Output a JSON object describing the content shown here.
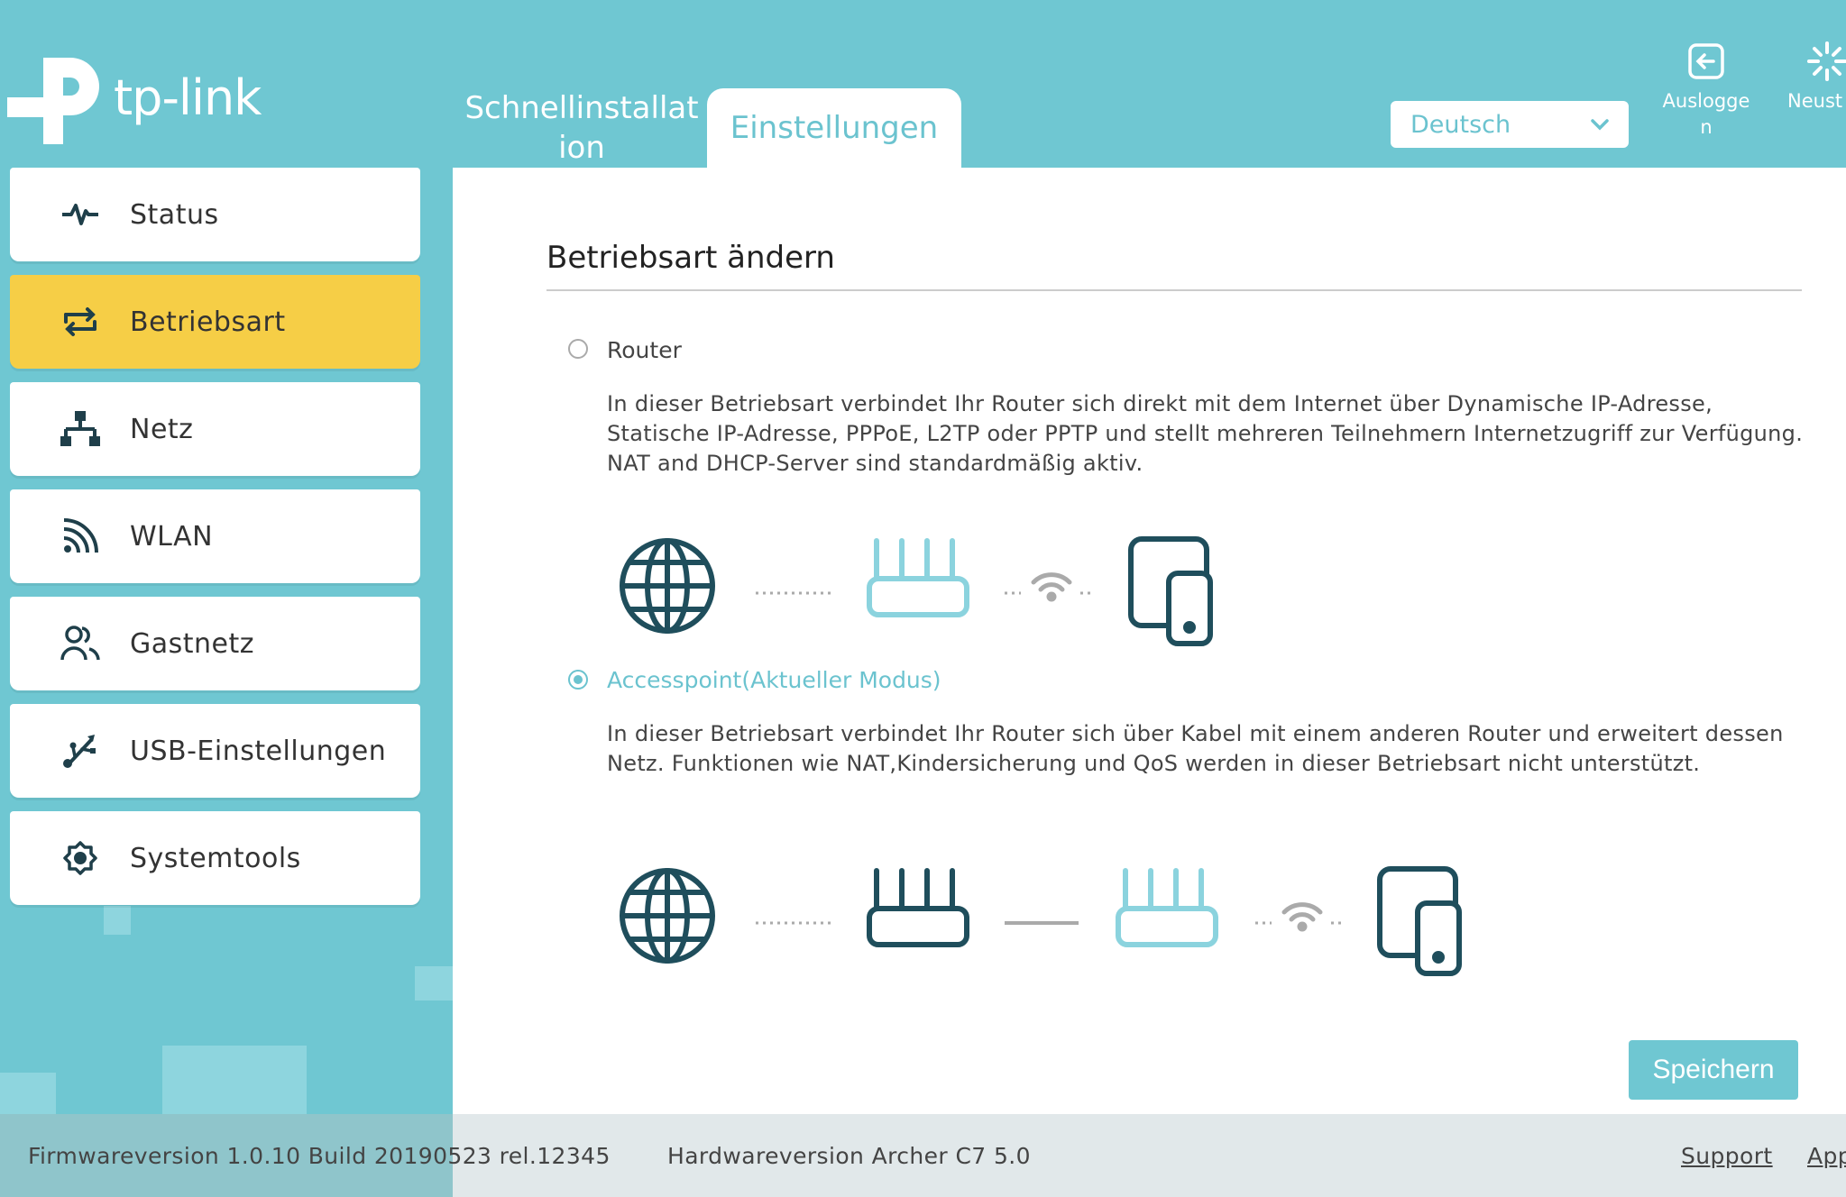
{
  "header": {
    "logo_text": "tp-link",
    "tabs": [
      {
        "label": "Schnellinstallat\nion"
      },
      {
        "label": "Einstellungen"
      }
    ],
    "language": {
      "selected": "Deutsch"
    },
    "logout_label": "Ausloggen",
    "reboot_label": "Neust"
  },
  "sidebar": {
    "items": [
      {
        "label": "Status",
        "icon": "pulse-icon"
      },
      {
        "label": "Betriebsart",
        "icon": "mode-switch-icon",
        "active": true
      },
      {
        "label": "Netz",
        "icon": "network-icon"
      },
      {
        "label": "WLAN",
        "icon": "wifi-icon"
      },
      {
        "label": "Gastnetz",
        "icon": "guests-icon"
      },
      {
        "label": "USB-Einstellungen",
        "icon": "usb-icon"
      },
      {
        "label": "Systemtools",
        "icon": "gear-icon"
      }
    ]
  },
  "main": {
    "title": "Betriebsart ändern",
    "options": [
      {
        "label": "Router",
        "selected": false,
        "description": "In dieser Betriebsart verbindet Ihr Router sich direkt mit dem Internet über Dynamische IP-Adresse, Statische IP-Adresse, PPPoE, L2TP oder PPTP und stellt mehreren Teilnehmern Internetzugriff zur Verfügung. NAT and DHCP-Server sind standardmäßig aktiv."
      },
      {
        "label": "Accesspoint(Aktueller Modus)",
        "selected": true,
        "description": "In dieser Betriebsart verbindet Ihr Router sich über Kabel mit einem anderen Router und erweitert dessen Netz. Funktionen wie NAT,Kindersicherung und QoS werden in dieser Betriebsart nicht unterstützt."
      }
    ],
    "save_label": "Speichern"
  },
  "footer": {
    "firmware": "Firmwareversion 1.0.10 Build 20190523 rel.12345",
    "hardware": "Hardwareversion Archer C7 5.0",
    "support_label": "Support",
    "app_label": "App"
  },
  "colors": {
    "accent": "#6fc7d2",
    "active": "#f6ce46",
    "dark_icon": "#1f4e5c"
  }
}
